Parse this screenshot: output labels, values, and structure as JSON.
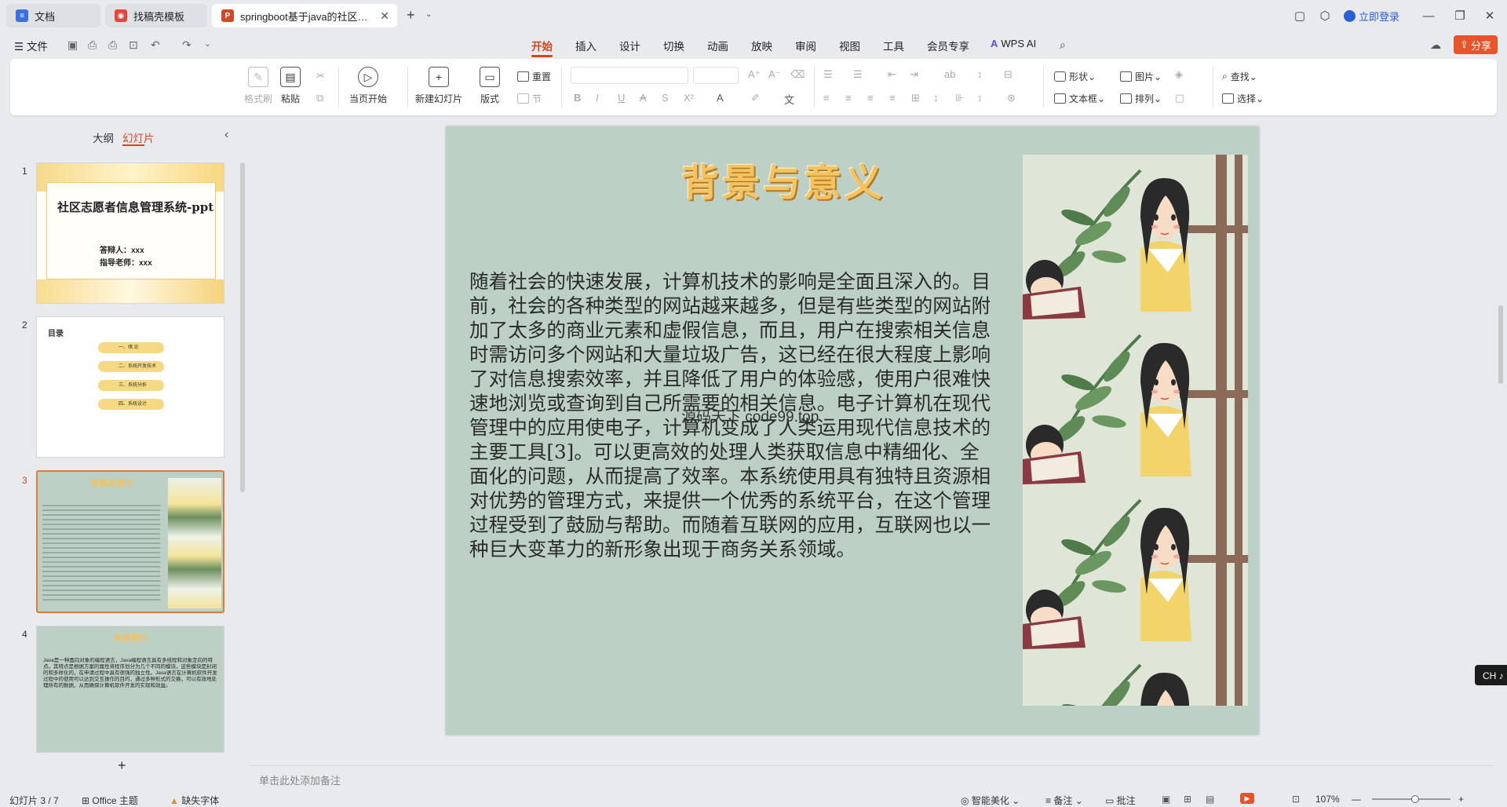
{
  "tabs": [
    {
      "label": "文档",
      "icon": "doc-icon",
      "color": "#3a6fe0"
    },
    {
      "label": "找稿壳模板",
      "icon": "template-icon",
      "color": "#e0463a"
    },
    {
      "label": "springboot基于java的社区…",
      "icon": "ppt-icon",
      "color": "#d24726"
    }
  ],
  "window": {
    "login": "立即登录"
  },
  "menu": {
    "file": "文件",
    "items": [
      "开始",
      "插入",
      "设计",
      "切换",
      "动画",
      "放映",
      "审阅",
      "视图",
      "工具",
      "会员专享"
    ],
    "wps_ai": "WPS AI",
    "share": "分享"
  },
  "ribbon": {
    "format_painter": "格式刷",
    "paste": "粘贴",
    "play_from_current": "当页开始",
    "new_slide": "新建幻灯片",
    "layout": "版式",
    "reset": "重置",
    "section": "节",
    "shape": "形状",
    "picture": "图片",
    "textbox": "文本框",
    "arrange": "排列",
    "find": "查找",
    "select": "选择"
  },
  "left_panel": {
    "outline_tab": "大纲",
    "slides_tab": "幻灯片"
  },
  "thumbnails": [
    {
      "num": "1",
      "title": "社区志愿者信息管理系统-ppt",
      "line1": "答辩人：xxx",
      "line2": "指导老师：xxx"
    },
    {
      "num": "2",
      "title": "目录",
      "items": [
        "一、绪 论",
        "二、系统开发技术",
        "三、系统分析",
        "四、系统设计"
      ]
    },
    {
      "num": "3",
      "title": "背景与意义"
    },
    {
      "num": "4",
      "title": "系统简介",
      "body": "Java是一种面向对象的编程语言，Java编程语言具有多线程和对象定向的特点。其特点是根据方案的属性将程序划分为几个不同的模块，这些模块是封闭的和多样化的，在申请过程中具有很强的独立性。Java语言在计算机软件开发过程中的使用可以达到交互操作的目的，通过多种形式的交换，可以有效地处理所有的数据，从而确保计算机软件开发的实现和效益。"
    }
  ],
  "slide": {
    "title": "背景与意义",
    "body": "随着社会的快速发展，计算机技术的影响是全面且深入的。目前，社会的各种类型的网站越来越多，但是有些类型的网站附加了太多的商业元素和虚假信息，而且，用户在搜索相关信息时需访问多个网站和大量垃圾广告，这已经在很大程度上影响了对信息搜索效率，并且降低了用户的体验感，使用户很难快速地浏览或查询到自己所需要的相关信息。电子计算机在现代管理中的应用使电子，计算机变成了人类运用现代信息技术的主要工具[3]。可以更高效的处理人类获取信息中精细化、全面化的问题，从而提高了效率。本系统使用具有独特且资源相对优势的管理方式，来提供一个优秀的系统平台，在这个管理过程受到了鼓励与帮助。而随着互联网的应用，互联网也以一种巨大变革力的新形象出现于商务关系领域。",
    "watermark": "源码天下 code99.top"
  },
  "notes_placeholder": "单击此处添加备注",
  "status": {
    "slide_count": "幻灯片 3 / 7",
    "theme": "Office 主题",
    "missing_font": "缺失字体",
    "beautify": "智能美化",
    "notes": "备注",
    "comments": "批注",
    "zoom": "107%"
  },
  "ime": "CH ♪ 简",
  "colors": {
    "accent": "#d2461c",
    "slide_bg": "#bdd0c6",
    "title_gold": "#f4c25e"
  }
}
